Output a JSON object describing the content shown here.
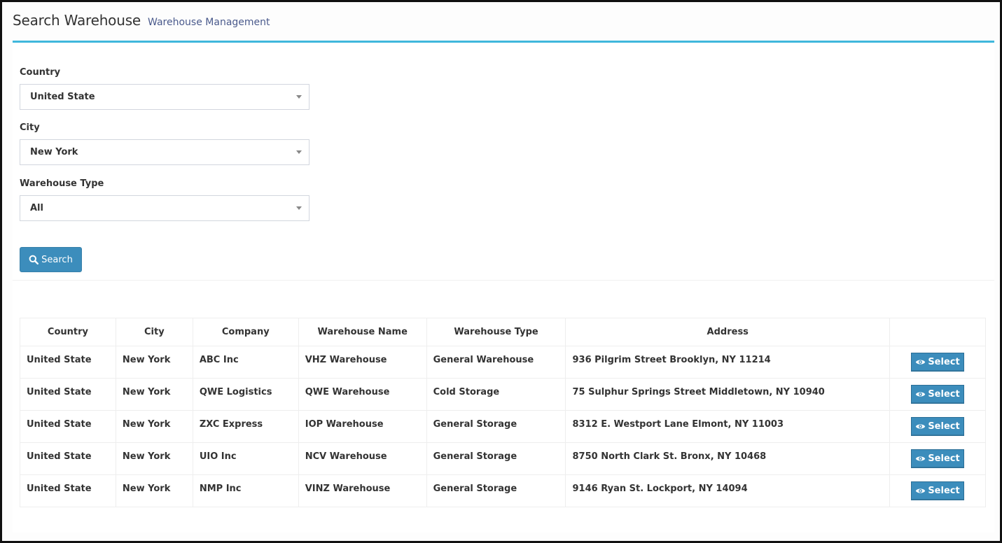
{
  "header": {
    "title": "Search Warehouse",
    "subtitle": "Warehouse Management"
  },
  "form": {
    "country": {
      "label": "Country",
      "value": "United State"
    },
    "city": {
      "label": "City",
      "value": "New York"
    },
    "warehouse_type": {
      "label": "Warehouse Type",
      "value": "All"
    },
    "search_label": "Search"
  },
  "table": {
    "columns": [
      "Country",
      "City",
      "Company",
      "Warehouse Name",
      "Warehouse Type",
      "Address",
      ""
    ],
    "action_label": "Select",
    "rows": [
      [
        "United State",
        "New York",
        "ABC Inc",
        "VHZ Warehouse",
        "General Warehouse",
        "936 Pilgrim Street Brooklyn, NY 11214"
      ],
      [
        "United State",
        "New York",
        "QWE Logistics",
        "QWE Warehouse",
        "Cold Storage",
        "75 Sulphur Springs Street Middletown, NY 10940"
      ],
      [
        "United State",
        "New York",
        "ZXC Express",
        "IOP Warehouse",
        "General Storage",
        "8312 E. Westport Lane Elmont, NY 11003"
      ],
      [
        "United State",
        "New York",
        "UIO Inc",
        "NCV Warehouse",
        "General Storage",
        "8750 North Clark St. Bronx, NY 10468"
      ],
      [
        "United State",
        "New York",
        "NMP Inc",
        "VINZ Warehouse",
        "General Storage",
        "9146 Ryan St. Lockport, NY 14094"
      ]
    ]
  },
  "icons": {
    "search_button_icon": "search-icon",
    "select_button_icon": "eye-icon",
    "dropdown_icon": "caret-down-icon"
  },
  "colors": {
    "accent_line": "#3fb7dc",
    "primary_button": "#3c8dbc",
    "subtitle": "#4a5a8c"
  }
}
